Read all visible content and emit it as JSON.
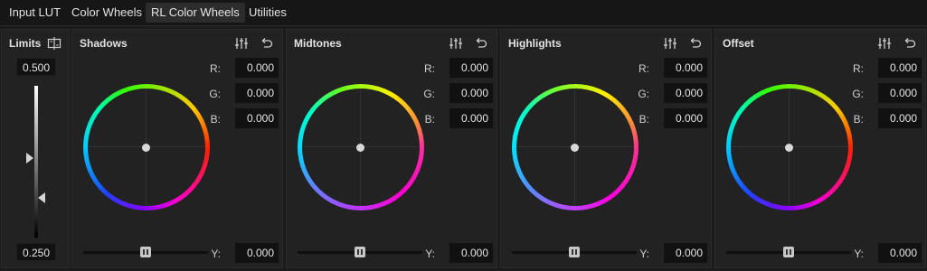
{
  "tabs": [
    {
      "label": "Input LUT"
    },
    {
      "label": "Color Wheels"
    },
    {
      "label": "RL Color Wheels"
    },
    {
      "label": "Utilities"
    }
  ],
  "active_tab": "RL Color Wheels",
  "limits": {
    "title": "Limits",
    "top_value": "0.500",
    "bottom_value": "0.250"
  },
  "wheels": [
    {
      "title": "Shadows",
      "r": "0.000",
      "g": "0.000",
      "b": "0.000",
      "y": "0.000"
    },
    {
      "title": "Midtones",
      "r": "0.000",
      "g": "0.000",
      "b": "0.000",
      "y": "0.000"
    },
    {
      "title": "Highlights",
      "r": "0.000",
      "g": "0.000",
      "b": "0.000",
      "y": "0.000"
    },
    {
      "title": "Offset",
      "r": "0.000",
      "g": "0.000",
      "b": "0.000",
      "y": "0.000"
    }
  ],
  "labels": {
    "r": "R:",
    "g": "G:",
    "b": "B:",
    "y": "Y:"
  },
  "icons": {
    "limits_toggle": "split-view-icon",
    "mode": "sliders-icon",
    "reset": "undo-icon"
  },
  "colors": {
    "background": "#1b1b1b",
    "panel": "#222222",
    "field": "#111111",
    "active_tab": "#2c2c2c"
  }
}
